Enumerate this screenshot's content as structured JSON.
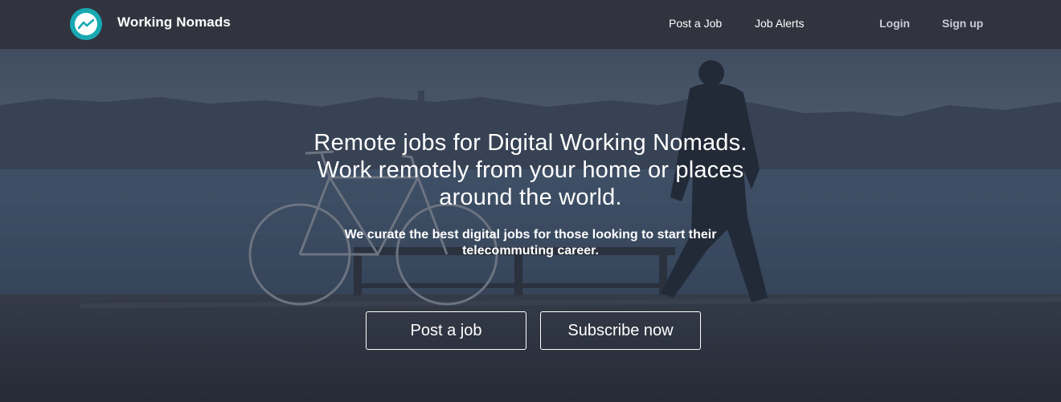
{
  "header": {
    "brand": "Working Nomads",
    "nav": {
      "post_job": "Post a Job",
      "job_alerts": "Job Alerts",
      "login": "Login",
      "signup": "Sign up"
    }
  },
  "hero": {
    "headline_lines": [
      "Remote jobs for Digital Working Nomads.",
      "Work remotely from your home or places",
      "around the world."
    ],
    "subhead_lines": [
      "We curate the best digital jobs for those looking to start their",
      "telecommuting career."
    ],
    "buttons": {
      "post_job": "Post a job",
      "subscribe": "Subscribe now"
    }
  },
  "colors": {
    "header_bg": "#31333f",
    "logo_accent": "#18a9b2",
    "hero_overlay": "#2a3547"
  },
  "icons": {
    "logo": "working-nomads-logo-icon"
  }
}
